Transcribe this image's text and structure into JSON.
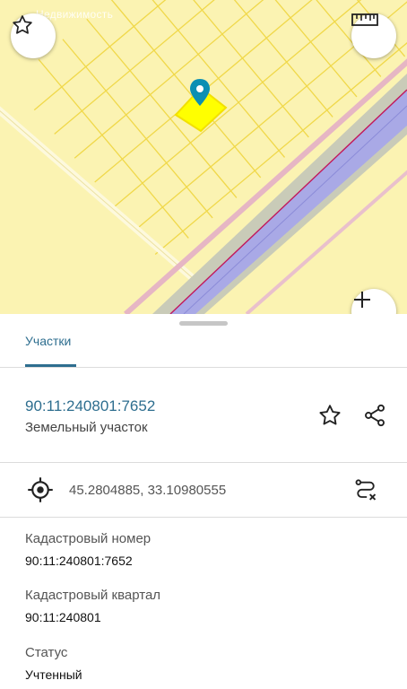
{
  "map": {
    "watermark": "Недвижимость",
    "accent": "#0b8fb3",
    "marker_color": "#0b8fb3"
  },
  "sheet": {
    "tab_label": "Участки",
    "parcel": {
      "id": "90:11:240801:7652",
      "type": "Земельный участок"
    },
    "coordinates": "45.2804885, 33.10980555",
    "fields": [
      {
        "label": "Кадастровый номер",
        "value": "90:11:240801:7652"
      },
      {
        "label": "Кадастровый квартал",
        "value": "90:11:240801"
      },
      {
        "label": "Статус",
        "value": "Учтенный"
      }
    ]
  },
  "icons": {
    "favorite": "star-icon",
    "ruler": "ruler-icon",
    "zoom": "plus-icon",
    "share": "share-icon",
    "location": "crosshair-icon",
    "route": "route-icon",
    "marker": "map-pin-icon"
  }
}
